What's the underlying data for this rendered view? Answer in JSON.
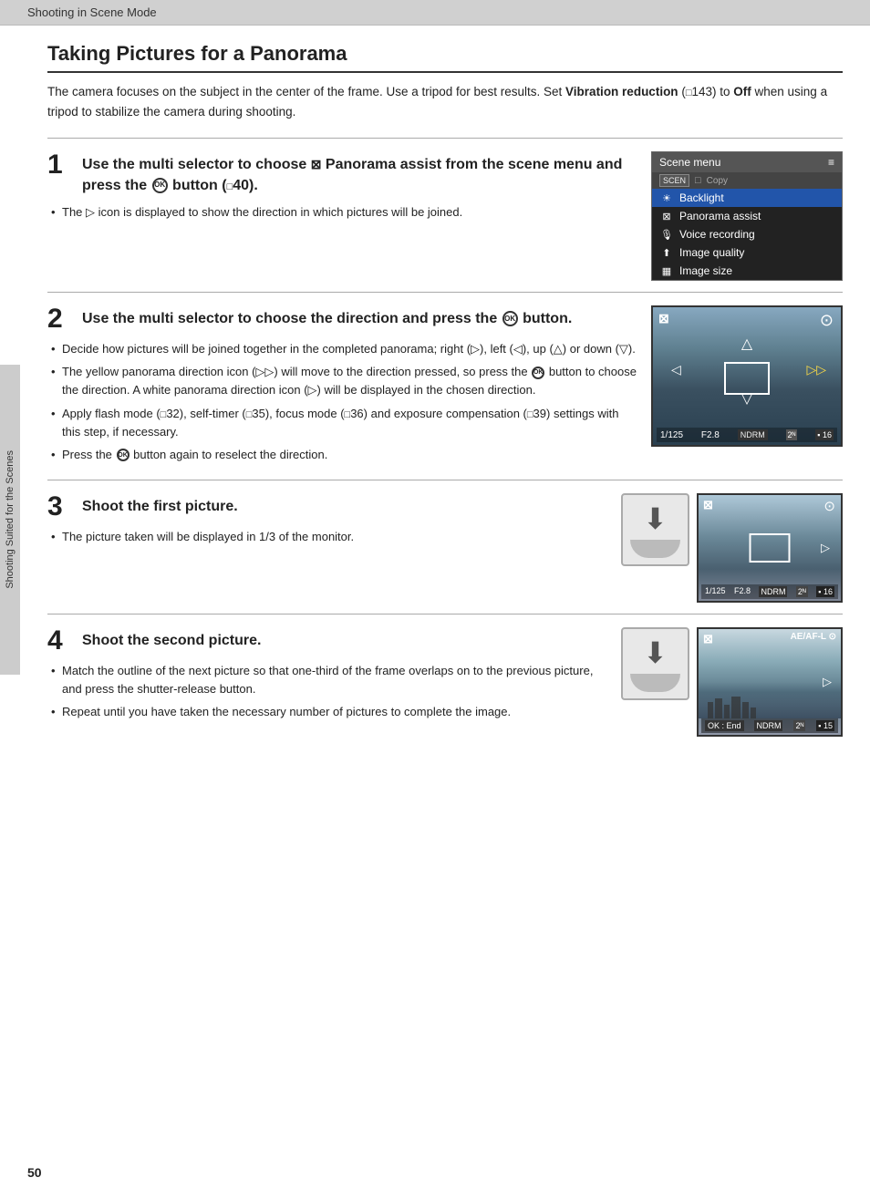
{
  "header": {
    "title": "Shooting in Scene Mode"
  },
  "page": {
    "title": "Taking Pictures for a Panorama",
    "intro": "The camera focuses on the subject in the center of the frame. Use a tripod for best results. Set ",
    "intro_bold": "Vibration reduction",
    "intro_ref": "143",
    "intro_end": " to ",
    "intro_off": "Off",
    "intro_rest": " when using a tripod to stabilize the camera during shooting."
  },
  "steps": [
    {
      "number": "1",
      "title_pre": "Use the multi selector to choose ",
      "title_icon": "⊠",
      "title_bold": "Panorama assist",
      "title_post": " from the scene menu and press the ",
      "title_btn": "OK",
      "title_end": " button (",
      "title_ref": "40",
      "title_close": ").",
      "bullets": [
        "The ▷ icon is displayed to show the direction in which pictures will be joined."
      ]
    },
    {
      "number": "2",
      "title": "Use the multi selector to choose the direction and press the ",
      "title_btn": "OK",
      "title_end": " button.",
      "bullets": [
        "Decide how pictures will be joined together in the completed panorama; right (▷), left (◁), up (△) or down (▽).",
        "The yellow panorama direction icon (▷▷) will move to the direction pressed, so press the  button to choose the direction. A white panorama direction icon (▷) will be displayed in the chosen direction.",
        "Apply flash mode (□32), self-timer (□35), focus mode (□36) and exposure compensation (□39) settings with this step, if necessary.",
        "Press the  button again to reselect the direction."
      ]
    },
    {
      "number": "3",
      "title": "Shoot the first picture.",
      "bullets": [
        "The picture taken will be displayed in 1/3 of the monitor."
      ]
    },
    {
      "number": "4",
      "title": "Shoot the second picture.",
      "bullets": [
        "Match the outline of the next picture so that one-third of the frame overlaps on to the previous picture, and press the shutter-release button.",
        "Repeat until you have taken the necessary number of pictures to complete the image."
      ]
    }
  ],
  "scene_menu": {
    "header": "Scene menu",
    "items": [
      {
        "label": "Copy",
        "icon": "📋",
        "highlighted": false
      },
      {
        "label": "Backlight",
        "icon": "☀",
        "highlighted": true
      },
      {
        "label": "Panorama assist",
        "icon": "⊠",
        "highlighted": false
      },
      {
        "label": "Voice recording",
        "icon": "🎙",
        "highlighted": false
      },
      {
        "label": "Image quality",
        "icon": "⬆",
        "highlighted": false
      },
      {
        "label": "Image size",
        "icon": "▦",
        "highlighted": false
      }
    ]
  },
  "camera_displays": [
    {
      "id": "step2",
      "top_left": "⊠",
      "top_right": "⊙",
      "shutter": "1/125",
      "aperture": "F2.8",
      "frames": "16"
    },
    {
      "id": "step3",
      "top_left": "⊠",
      "top_right": "⊙",
      "shutter": "1/125",
      "aperture": "F2.8",
      "frames": "16"
    },
    {
      "id": "step4",
      "top_left": "⊠",
      "top_right": "AE/AF-L ⊙",
      "shutter": "OK : End",
      "aperture": "",
      "frames": "15"
    }
  ],
  "side_tab": "Shooting Suited for the Scenes",
  "page_number": "50"
}
